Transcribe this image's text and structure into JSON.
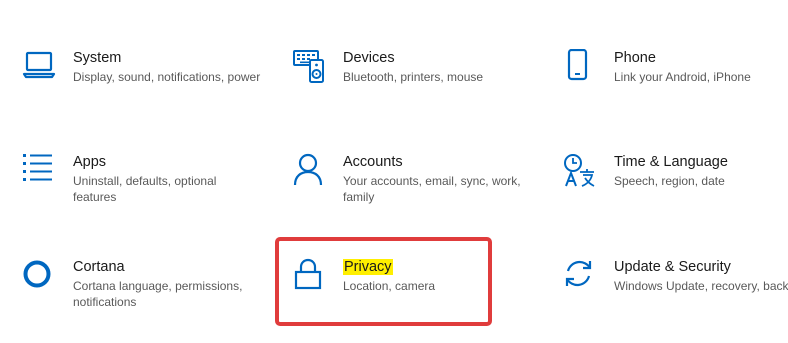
{
  "accent_color": "#0067c0",
  "annotation_color": "#e03c3c",
  "highlight_color": "#ffef00",
  "tiles": [
    {
      "title": "System",
      "desc": "Display, sound, notifications, power",
      "icon": "laptop-icon"
    },
    {
      "title": "Devices",
      "desc": "Bluetooth, printers, mouse",
      "icon": "keyboard-speaker-icon"
    },
    {
      "title": "Phone",
      "desc": "Link your Android, iPhone",
      "icon": "phone-icon"
    },
    {
      "title": "Apps",
      "desc": "Uninstall, defaults, optional features",
      "icon": "apps-list-icon"
    },
    {
      "title": "Accounts",
      "desc": "Your accounts, email, sync, work, family",
      "icon": "person-icon"
    },
    {
      "title": "Time & Language",
      "desc": "Speech, region, date",
      "icon": "time-language-icon"
    },
    {
      "title": "Cortana",
      "desc": "Cortana language, permissions, notifications",
      "icon": "cortana-circle-icon"
    },
    {
      "title": "Privacy",
      "desc": "Location, camera",
      "icon": "lock-icon"
    },
    {
      "title": "Update & Security",
      "desc": "Windows Update, recovery, backup",
      "icon": "sync-arrows-icon"
    }
  ]
}
